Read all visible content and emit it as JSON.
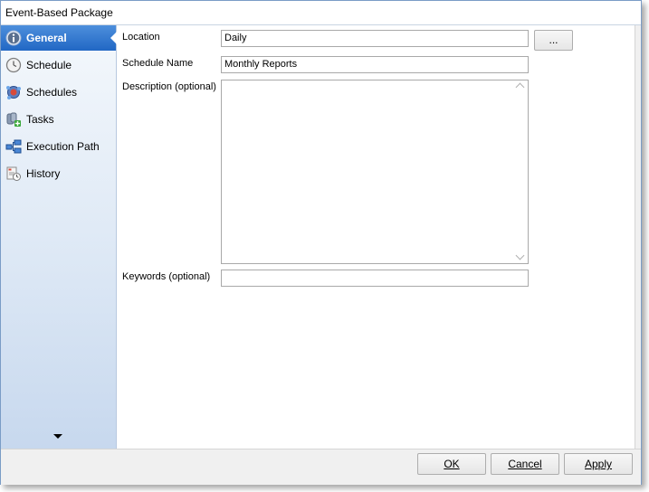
{
  "window": {
    "title": "Event-Based Package"
  },
  "sidebar": {
    "items": [
      {
        "label": "General",
        "icon": "info-icon",
        "active": true
      },
      {
        "label": "Schedule",
        "icon": "clock-icon"
      },
      {
        "label": "Schedules",
        "icon": "schedules-icon"
      },
      {
        "label": "Tasks",
        "icon": "tasks-icon"
      },
      {
        "label": "Execution Path",
        "icon": "execution-path-icon"
      },
      {
        "label": "History",
        "icon": "history-icon"
      }
    ],
    "scroll_icon": "scroll-down-arrow"
  },
  "form": {
    "location": {
      "label": "Location",
      "value": "Daily",
      "browse_label": "..."
    },
    "schedule_name": {
      "label": "Schedule Name",
      "value": "Monthly Reports"
    },
    "description": {
      "label": "Description (optional)",
      "value": ""
    },
    "keywords": {
      "label": "Keywords (optional)",
      "value": ""
    }
  },
  "buttons": {
    "ok": {
      "label": "OK"
    },
    "cancel": {
      "label": "Cancel"
    },
    "apply": {
      "label": "Apply"
    }
  },
  "colors": {
    "active_nav": "#2f78d0",
    "sidebar_bottom": "#c7d8ee",
    "window_border": "#7a9cc6"
  }
}
